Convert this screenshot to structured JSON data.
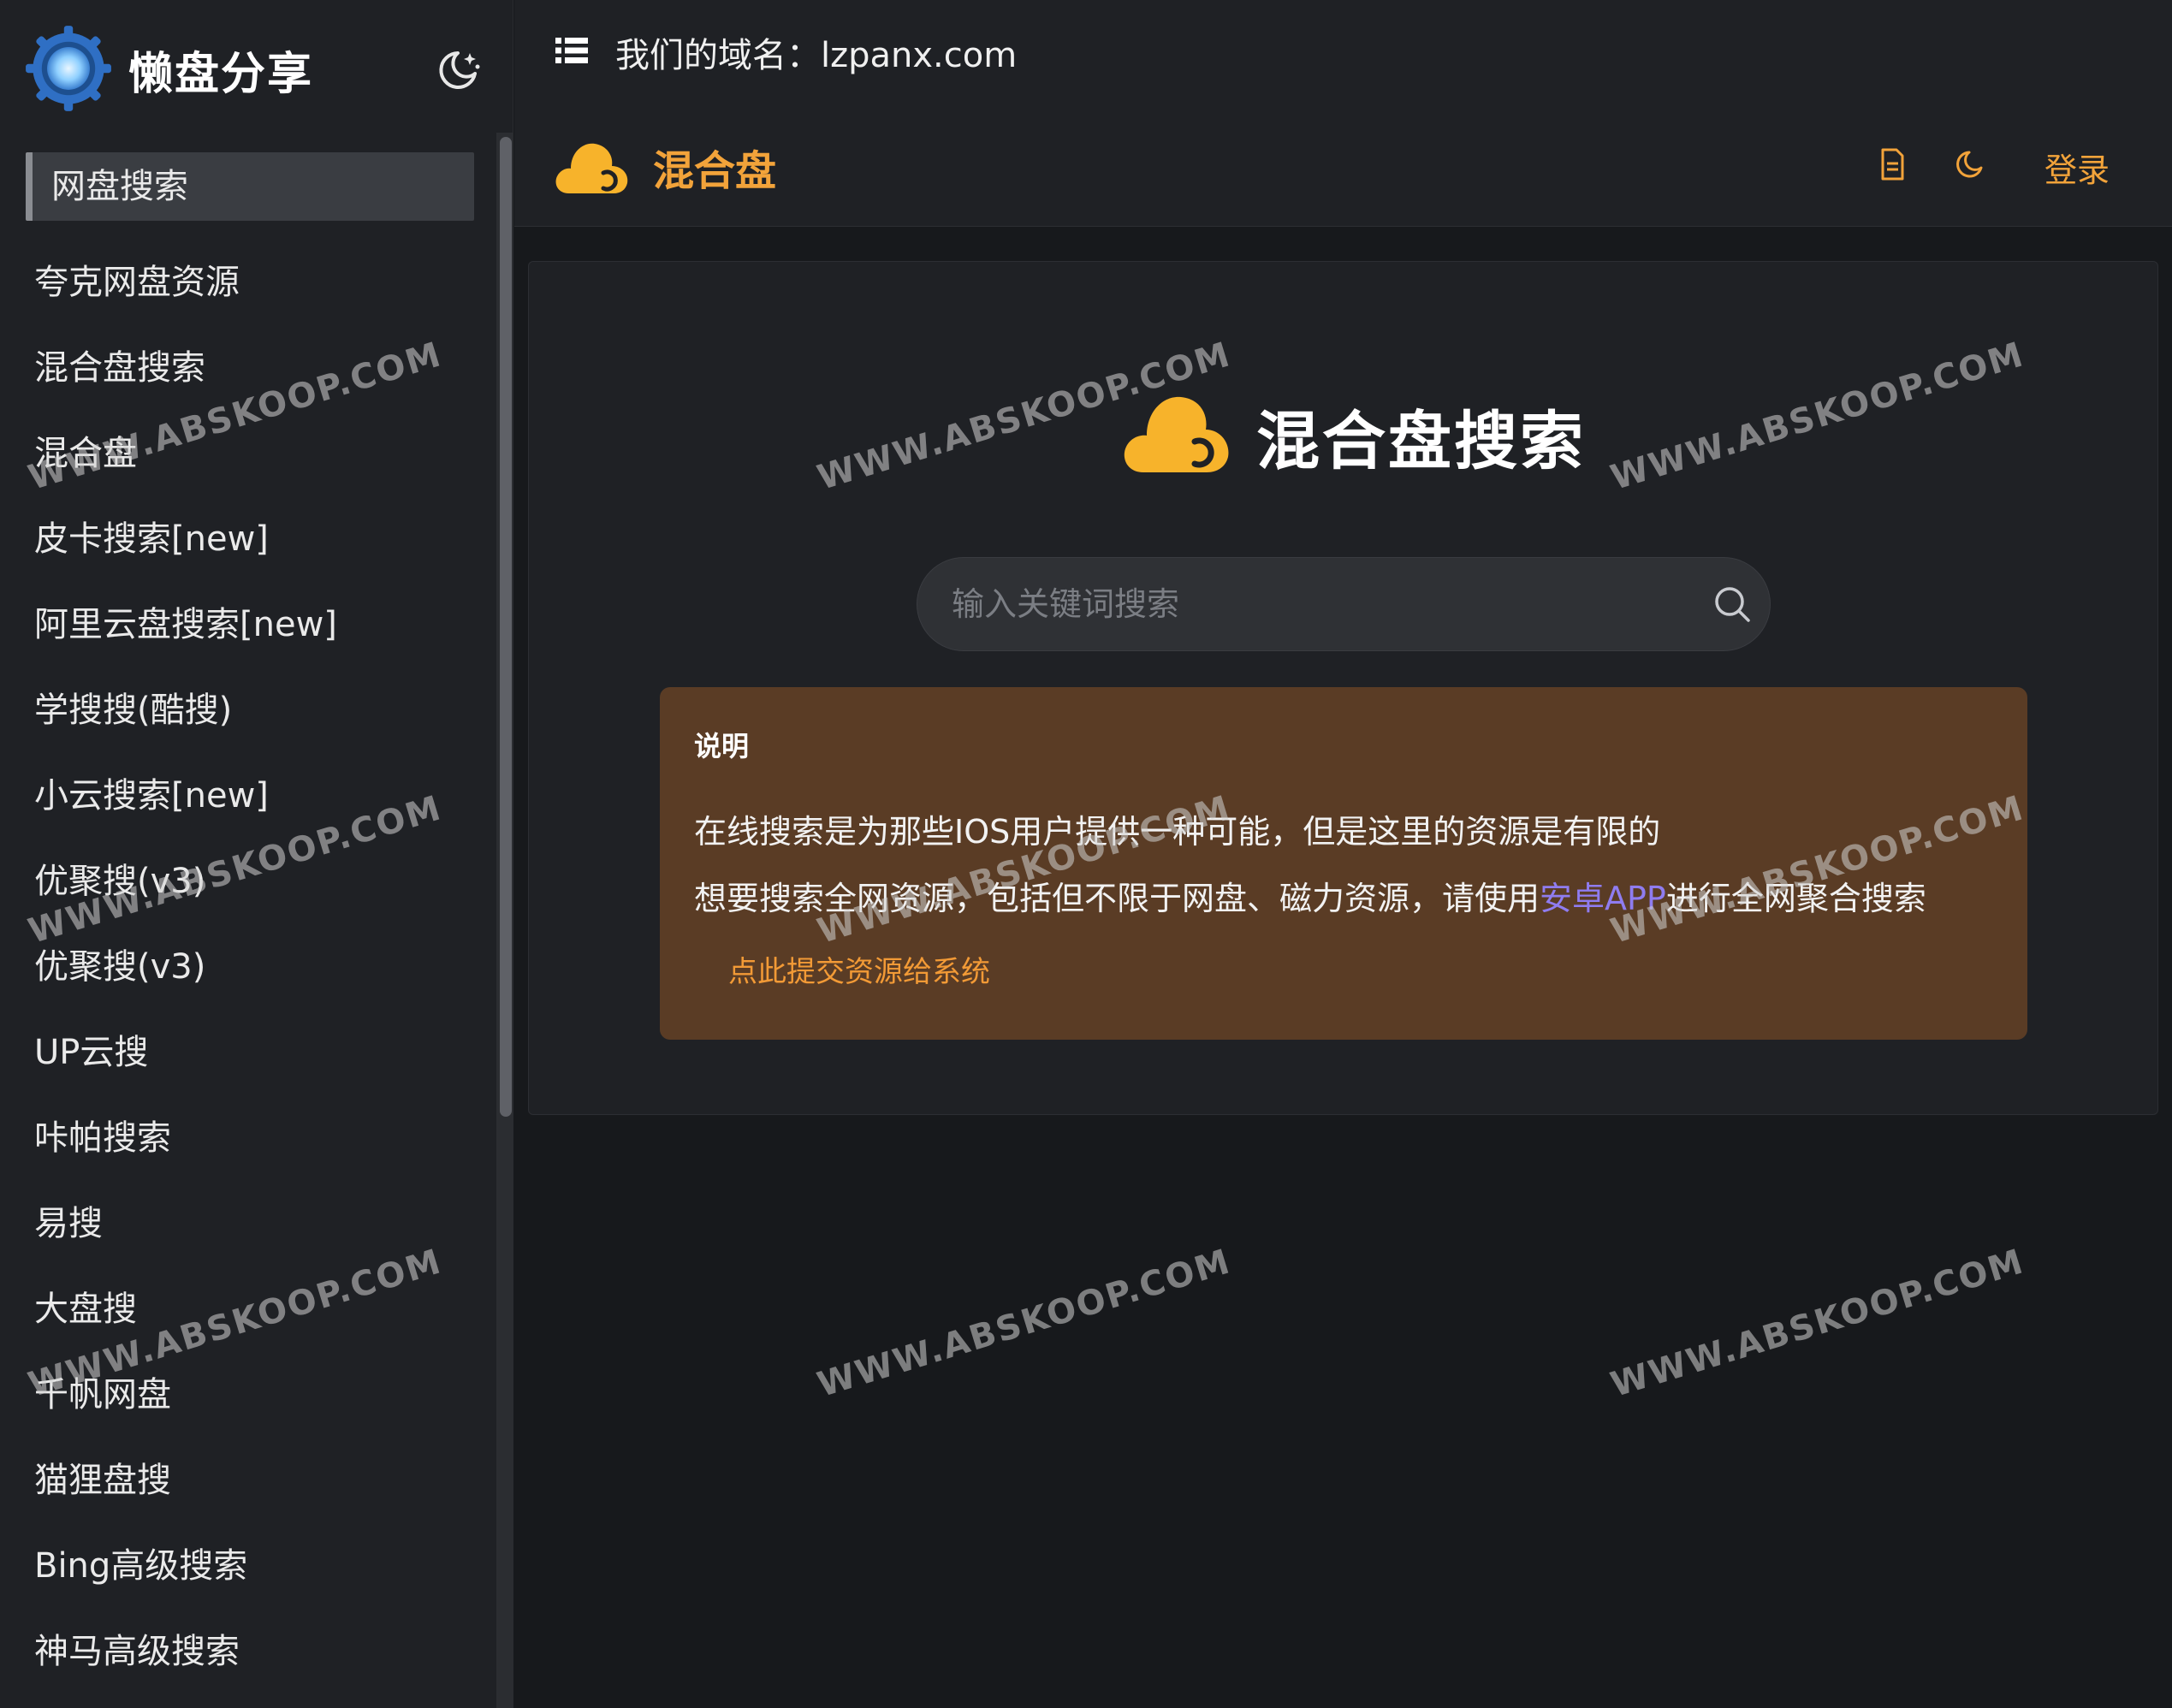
{
  "sidebar": {
    "brand": "懒盘分享",
    "nav": [
      {
        "label": "网盘搜索",
        "active": true
      },
      {
        "label": "夸克网盘资源"
      },
      {
        "label": "混合盘搜索"
      },
      {
        "label": "混合盘"
      },
      {
        "label": "皮卡搜索[new]"
      },
      {
        "label": "阿里云盘搜索[new]"
      },
      {
        "label": "学搜搜(酷搜)"
      },
      {
        "label": "小云搜索[new]"
      },
      {
        "label": "优聚搜(v3)"
      },
      {
        "label": "优聚搜(v3)"
      },
      {
        "label": "UP云搜"
      },
      {
        "label": "咔帕搜索"
      },
      {
        "label": "易搜"
      },
      {
        "label": "大盘搜"
      },
      {
        "label": "千帆网盘"
      },
      {
        "label": "猫狸盘搜"
      },
      {
        "label": "Bing高级搜索"
      },
      {
        "label": "神马高级搜索"
      }
    ]
  },
  "topbar": {
    "domain_text": "我们的域名：lzpanx.com"
  },
  "subheader": {
    "site_name": "混合盘",
    "login_label": "登录"
  },
  "main": {
    "hero_title": "混合盘搜索",
    "search": {
      "placeholder": "输入关键词搜索",
      "value": ""
    },
    "notice": {
      "title": "说明",
      "line1": "在线搜索是为那些IOS用户提供一种可能，但是这里的资源是有限的",
      "line2_prefix": "想要搜索全网资源，包括但不限于网盘、磁力资源，请使用",
      "line2_link": "安卓APP",
      "line2_suffix": "进行全网聚合搜索",
      "submit_link": "点此提交资源给系统"
    }
  },
  "watermark": "WWW.ABSKOOP.COM",
  "colors": {
    "accent": "#f2a33a",
    "notice_bg": "#5a3c25",
    "link": "#8f7cf0",
    "background": "#17191c",
    "panel": "#1f2125"
  }
}
